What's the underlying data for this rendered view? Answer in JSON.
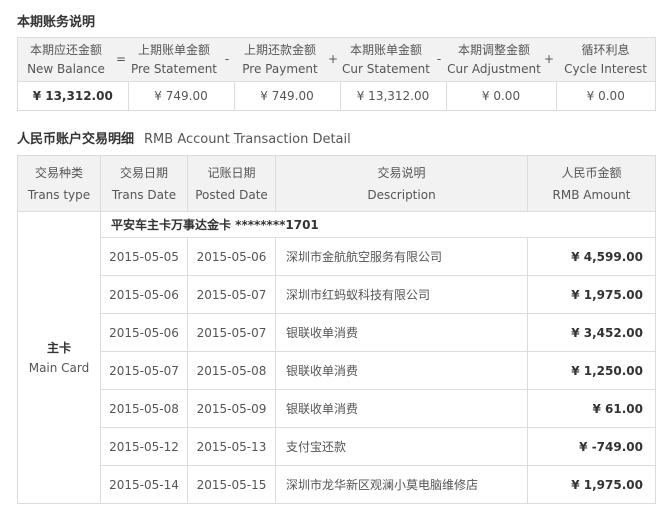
{
  "summary": {
    "title": "本期账务说明"
  },
  "balance": {
    "headers": [
      {
        "zh": "本期应还金额",
        "en": "New Balance"
      },
      {
        "zh": "上期账单金额",
        "en": "Pre Statement"
      },
      {
        "zh": "上期还款金额",
        "en": "Pre Payment"
      },
      {
        "zh": "本期账单金额",
        "en": "Cur Statement"
      },
      {
        "zh": "本期调整金额",
        "en": "Cur Adjustment"
      },
      {
        "zh": "循环利息",
        "en": "Cycle Interest"
      }
    ],
    "operators": [
      "=",
      "-",
      "+",
      "-",
      "+"
    ],
    "values": [
      "¥ 13,312.00",
      "¥ 749.00",
      "¥ 749.00",
      "¥ 13,312.00",
      "¥ 0.00",
      "¥ 0.00"
    ]
  },
  "rmb_section": {
    "title_zh": "人民币账户交易明细",
    "title_en": "RMB Account Transaction Detail"
  },
  "transactions": {
    "headers": [
      {
        "zh": "交易种类",
        "en": "Trans type"
      },
      {
        "zh": "交易日期",
        "en": "Trans Date"
      },
      {
        "zh": "记账日期",
        "en": "Posted Date"
      },
      {
        "zh": "交易说明",
        "en": "Description"
      },
      {
        "zh": "人民币金额",
        "en": "RMB Amount"
      }
    ],
    "card_title": "平安车主卡万事达金卡 ********1701",
    "type_zh": "主卡",
    "type_en": "Main Card",
    "rows": [
      {
        "trans_date": "2015-05-05",
        "posted_date": "2015-05-06",
        "description": "深圳市金航航空服务有限公司",
        "amount": "¥ 4,599.00"
      },
      {
        "trans_date": "2015-05-06",
        "posted_date": "2015-05-07",
        "description": "深圳市红蚂蚁科技有限公司",
        "amount": "¥ 1,975.00"
      },
      {
        "trans_date": "2015-05-06",
        "posted_date": "2015-05-07",
        "description": "银联收单消费",
        "amount": "¥ 3,452.00"
      },
      {
        "trans_date": "2015-05-07",
        "posted_date": "2015-05-08",
        "description": "银联收单消费",
        "amount": "¥ 1,250.00"
      },
      {
        "trans_date": "2015-05-08",
        "posted_date": "2015-05-09",
        "description": "银联收单消费",
        "amount": "¥ 61.00"
      },
      {
        "trans_date": "2015-05-12",
        "posted_date": "2015-05-13",
        "description": "支付宝还款",
        "amount": "¥ -749.00"
      },
      {
        "trans_date": "2015-05-14",
        "posted_date": "2015-05-15",
        "description": "深圳市龙华新区观澜小莫电脑维修店",
        "amount": "¥ 1,975.00"
      }
    ]
  }
}
